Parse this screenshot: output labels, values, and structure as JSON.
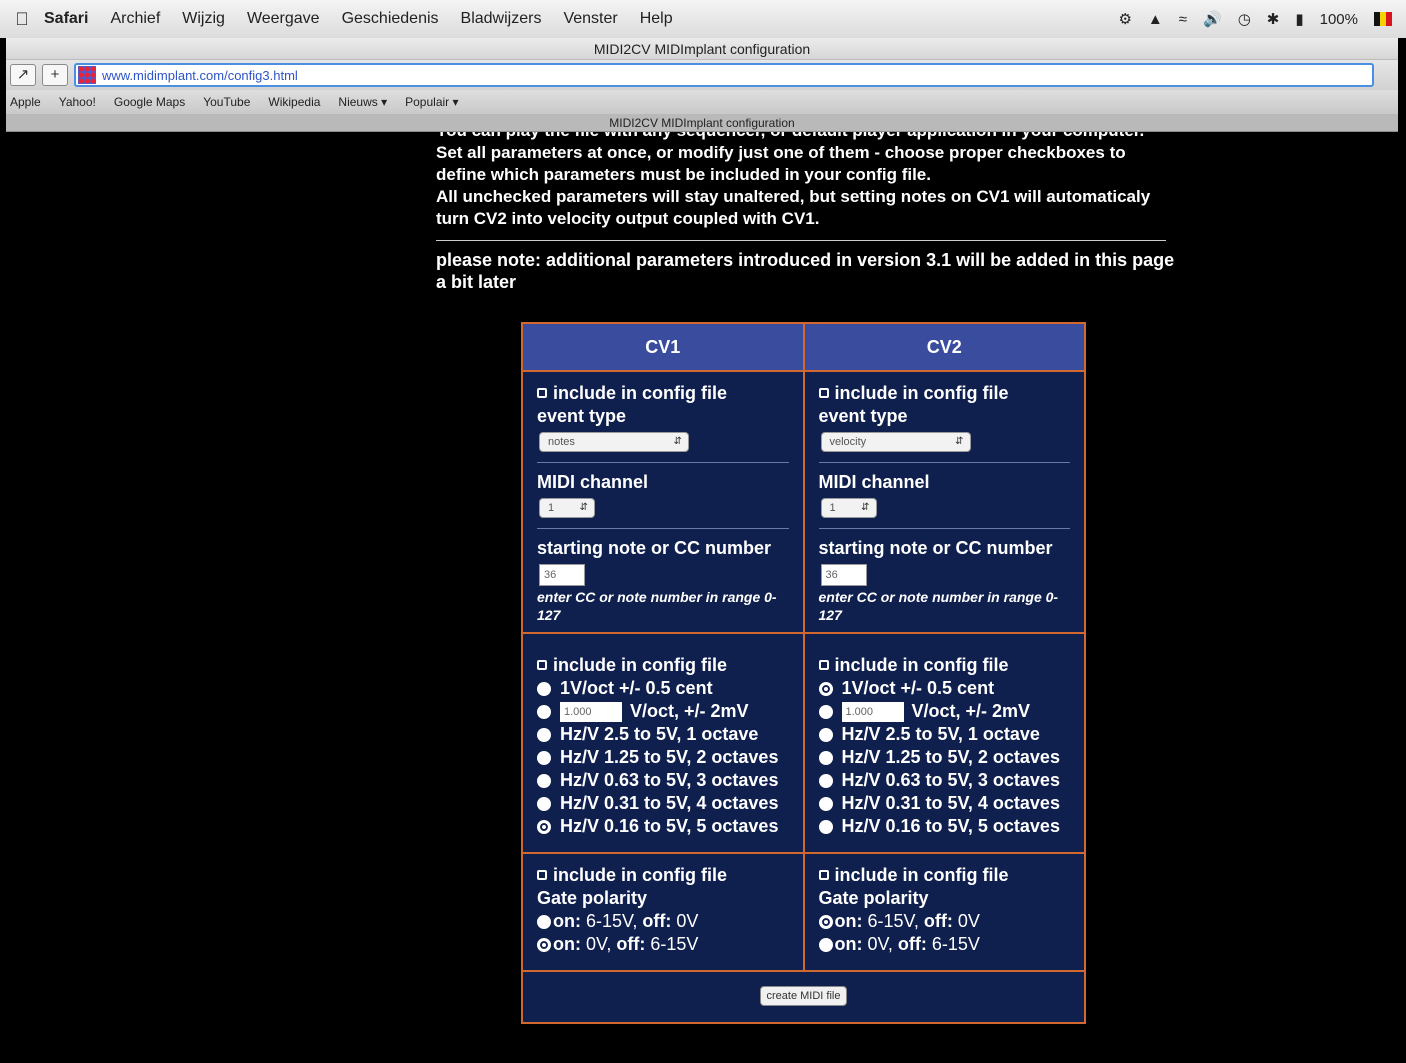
{
  "menubar": {
    "app": "Safari",
    "items": [
      "Archief",
      "Wijzig",
      "Weergave",
      "Geschiedenis",
      "Bladwijzers",
      "Venster",
      "Help"
    ],
    "battery": "100%"
  },
  "window": {
    "title": "MIDI2CV MIDImplant configuration",
    "url": "www.midimplant.com/config3.html",
    "tab_title": "MIDI2CV MIDImplant configuration"
  },
  "bookmarks": [
    "Apple",
    "Yahoo!",
    "Google Maps",
    "YouTube",
    "Wikipedia",
    "Nieuws ▾",
    "Populair ▾"
  ],
  "intro": {
    "line1": "You can play the file with any sequencer, or default player application in your computer.",
    "line2": "Set all parameters at once, or modify just one of them - choose proper checkboxes to define which parameters must be included in your config file.",
    "line3a": "All unchecked parameters will stay unaltered, but ",
    "line3b": "setting notes on CV1 will automaticaly turn CV2 into velocity output coupled with CV1.",
    "note": "please note: additional parameters introduced in version 3.1 will be added in this page a bit later"
  },
  "table": {
    "headers": [
      "CV1",
      "CV2"
    ],
    "include_label": "include in config file",
    "event_type_label": "event type",
    "midi_channel_label": "MIDI channel",
    "start_note_label": "starting note or CC number",
    "hint": "enter CC or note number in range 0-127",
    "cv1": {
      "event_type": "notes",
      "channel": "1",
      "start_note": "36",
      "vper_value": "1.000",
      "pitch_selected": 6,
      "gate_selected": 1
    },
    "cv2": {
      "event_type": "velocity",
      "channel": "1",
      "start_note": "36",
      "vper_value": "1.000",
      "pitch_selected": 0,
      "gate_selected": 0
    },
    "pitch_options": [
      "1V/oct +/- 0.5 cent",
      "V/oct, +/- 2mV",
      "Hz/V 2.5 to 5V, 1 octave",
      "Hz/V 1.25 to 5V, 2 octaves",
      "Hz/V 0.63 to 5V, 3 octaves",
      "Hz/V 0.31 to 5V, 4 octaves",
      "Hz/V 0.16 to 5V, 5 octaves"
    ],
    "gate_label": "Gate polarity",
    "gate_opt1_on": "on:",
    "gate_opt1_on_val": " 6-15V, ",
    "gate_opt1_off": "off:",
    "gate_opt1_off_val": " 0V",
    "gate_opt2_on": "on:",
    "gate_opt2_on_val": " 0V, ",
    "gate_opt2_off": "off:",
    "gate_opt2_off_val": " 6-15V",
    "create_button": "create MIDI file"
  }
}
